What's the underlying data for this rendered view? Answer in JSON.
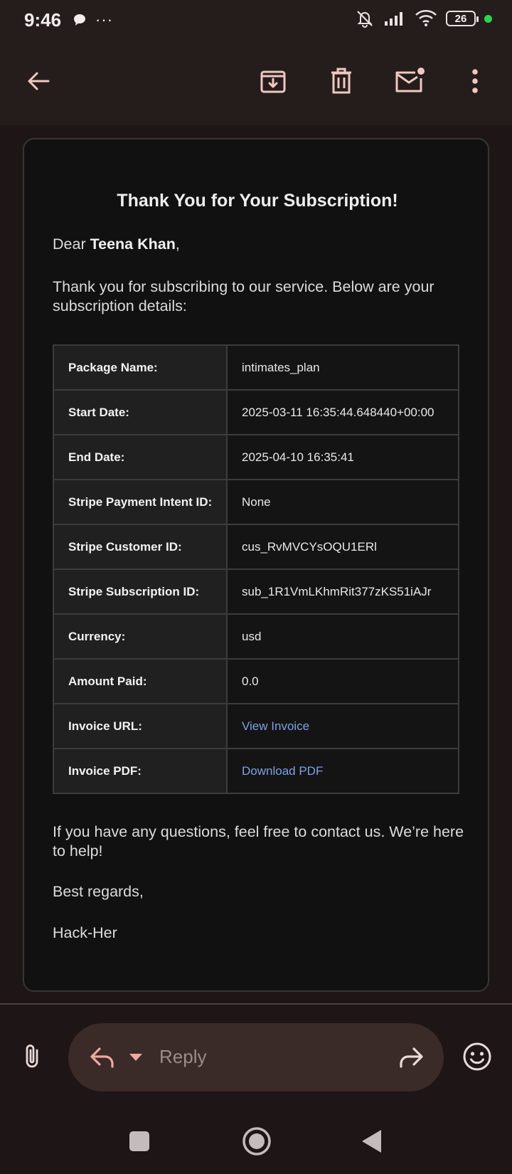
{
  "status_bar": {
    "time": "9:46",
    "overflow": "···",
    "battery": "26",
    "icons": [
      "chat-bubble-icon",
      "bell-off-icon",
      "signal-icon",
      "wifi-icon",
      "battery-icon"
    ]
  },
  "app_bar": {
    "icons": [
      "back-arrow-icon",
      "archive-icon",
      "delete-icon",
      "mark-unread-icon",
      "more-vert-icon"
    ]
  },
  "email": {
    "title": "Thank You for Your Subscription!",
    "greeting_prefix": "Dear ",
    "recipient": "Teena Khan",
    "greeting_suffix": ",",
    "intro": "Thank you for subscribing to our service. Below are your subscription details:",
    "details": [
      {
        "label": "Package Name:",
        "value": "intimates_plan"
      },
      {
        "label": "Start Date:",
        "value": "2025-03-11 16:35:44.648440+00:00"
      },
      {
        "label": "End Date:",
        "value": "2025-04-10 16:35:41"
      },
      {
        "label": "Stripe Payment Intent ID:",
        "value": "None"
      },
      {
        "label": "Stripe Customer ID:",
        "value": "cus_RvMVCYsOQU1ERl"
      },
      {
        "label": "Stripe Subscription ID:",
        "value": "sub_1R1VmLKhmRit377zKS51iAJr"
      },
      {
        "label": "Currency:",
        "value": "usd"
      },
      {
        "label": "Amount Paid:",
        "value": "0.0"
      },
      {
        "label": "Invoice URL:",
        "value": "View Invoice"
      },
      {
        "label": "Invoice PDF:",
        "value": "Download PDF"
      }
    ],
    "questions": "If you have any questions, feel free to contact us. We’re here to help!",
    "regards": "Best regards,",
    "signature": "Hack-Her"
  },
  "reply_bar": {
    "reply_label": "Reply",
    "icons": [
      "attachment-icon",
      "reply-icon",
      "reply-options-icon",
      "forward-icon",
      "emoji-icon"
    ]
  },
  "colors": {
    "background": "#1e1616",
    "card": "#111111",
    "link": "#7ea0e6",
    "accent": "#f0a8a0"
  }
}
